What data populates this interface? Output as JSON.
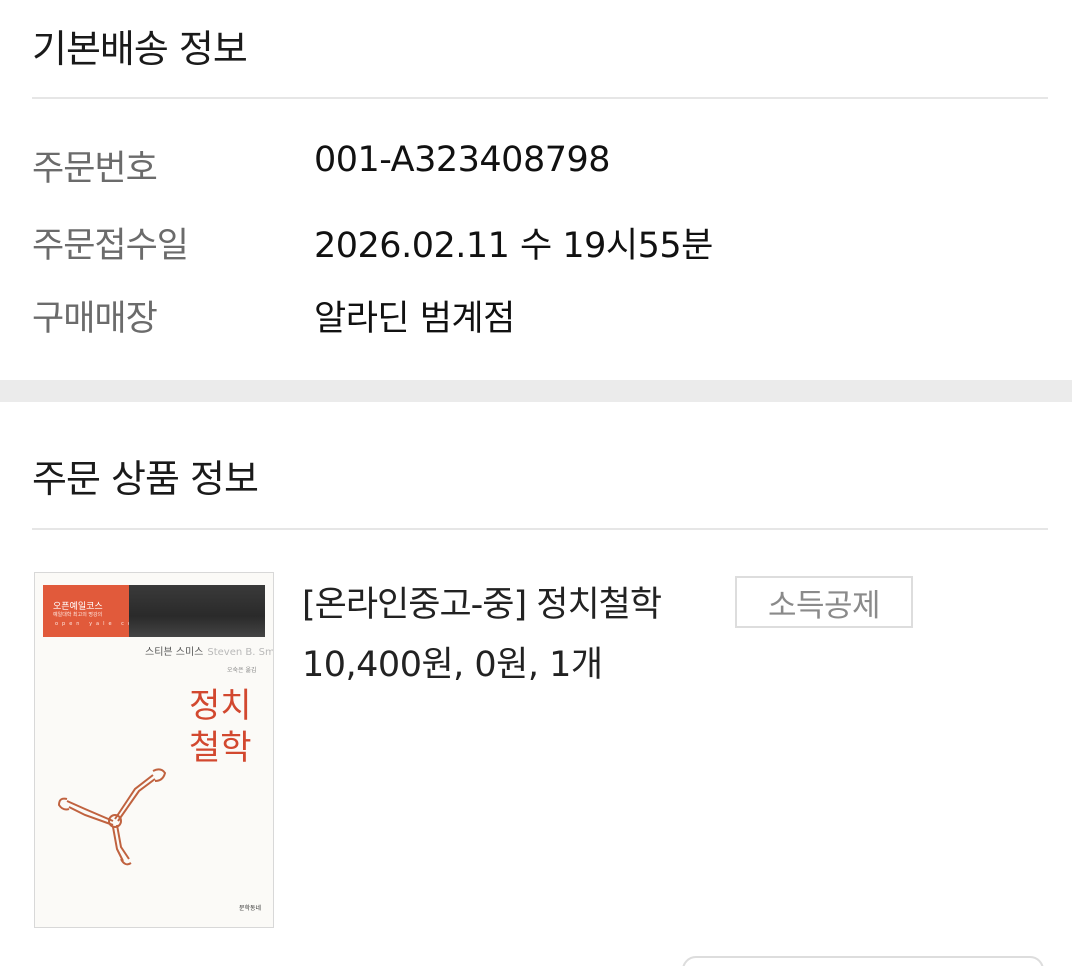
{
  "basic_info": {
    "title": "기본배송 정보",
    "rows": [
      {
        "label": "주문번호",
        "value": "001-A323408798"
      },
      {
        "label": "주문접수일",
        "value": "2026.02.11 수 19시55분"
      },
      {
        "label": "구매매장",
        "value": "알라딘 범계점"
      }
    ]
  },
  "product_info": {
    "title": "주문 상품 정보",
    "item": {
      "name": "[온라인중고-중] 정치철학",
      "badge": "소득공제",
      "price_line": "10,400원, 0원, 1개",
      "cover": {
        "series": "오픈예일코스",
        "series_sub": "예일대학 최고의 명강의",
        "open_yale": "open yale courses",
        "author_ko": "스티븐 스미스",
        "author_en": "Steven B. Smith",
        "translator": "오숙은 옮김",
        "title": "정치철학",
        "publisher": "문학동네",
        "accent_color": "#d2482f"
      }
    }
  },
  "colors": {
    "divider": "#e6e6e6",
    "band": "#ebebeb",
    "label_text": "#6b6b6b",
    "value_text": "#111111"
  }
}
